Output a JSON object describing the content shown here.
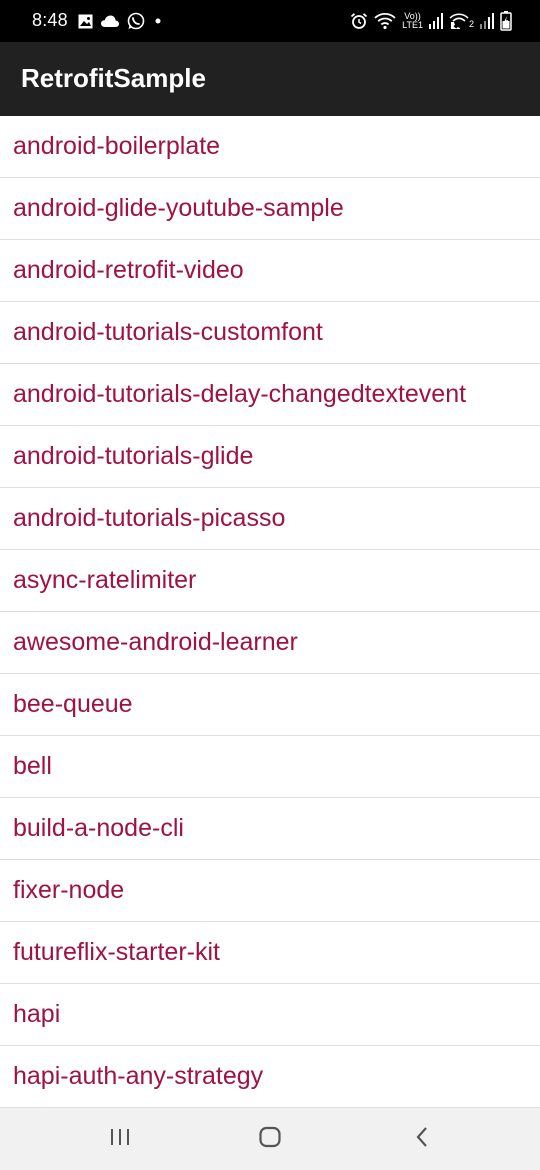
{
  "status_bar": {
    "time": "8:48",
    "left_icons": [
      "gallery-icon",
      "cloud-icon",
      "whatsapp-icon",
      "dot-icon"
    ],
    "right_icons": [
      "alarm-icon",
      "wifi-icon",
      "volte-icon",
      "signal-icon",
      "wifi-calling-icon",
      "signal-icon",
      "battery-icon"
    ],
    "volte_label": "Vo))",
    "lte_label": "LTE1",
    "sim2_label": "2"
  },
  "app_bar": {
    "title": "RetrofitSample"
  },
  "list": {
    "items": [
      "android-boilerplate",
      "android-glide-youtube-sample",
      "android-retrofit-video",
      "android-tutorials-customfont",
      "android-tutorials-delay-changedtextevent",
      "android-tutorials-glide",
      "android-tutorials-picasso",
      "async-ratelimiter",
      "awesome-android-learner",
      "bee-queue",
      "bell",
      "build-a-node-cli",
      "fixer-node",
      "futureflix-starter-kit",
      "hapi",
      "hapi-auth-any-strategy"
    ]
  },
  "nav_bar": {
    "buttons": [
      "recents-icon",
      "home-icon",
      "back-icon"
    ]
  },
  "colors": {
    "status_bar_bg": "#000000",
    "app_bar_bg": "#212121",
    "item_text": "#a01244",
    "divider": "#dedede",
    "nav_bg": "#f1f1f1"
  }
}
